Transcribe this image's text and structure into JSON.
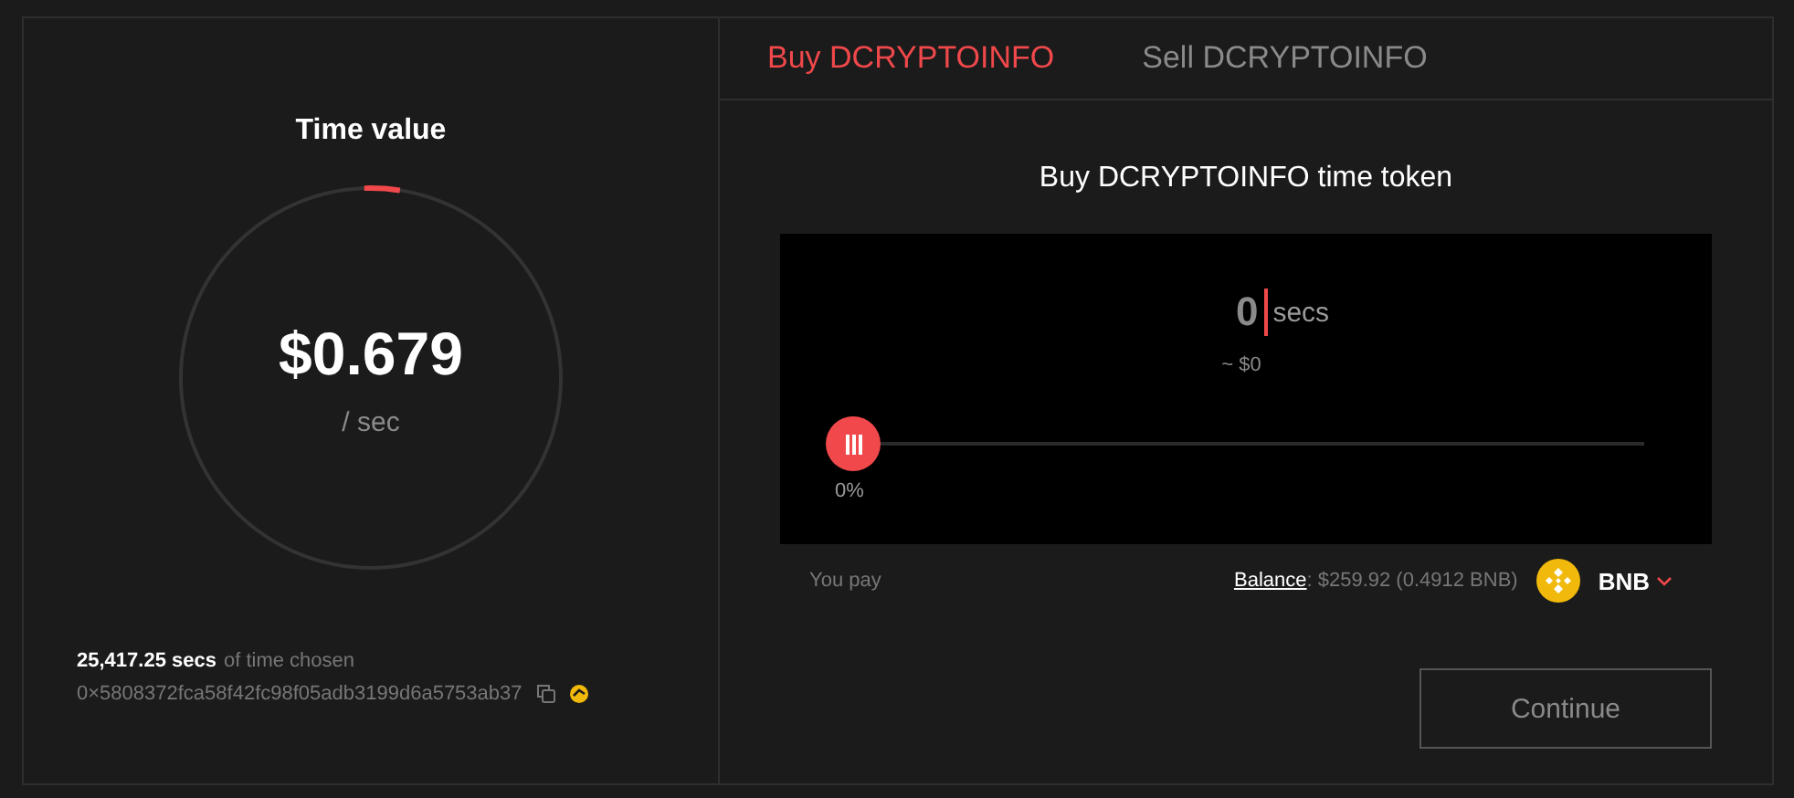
{
  "time_value": {
    "title": "Time value",
    "price": "$0.679",
    "unit": "/ sec",
    "level": 0.03
  },
  "chosen": {
    "amount": "25,417.25 secs",
    "suffix": "of time chosen",
    "address": "0×5808372fca58f42fc98f05adb3199d6a5753ab37"
  },
  "tabs": [
    {
      "label": "Buy DCRYPTOINFO",
      "selected": true
    },
    {
      "label": "Sell DCRYPTOINFO",
      "selected": false
    }
  ],
  "buy": {
    "title": "Buy DCRYPTOINFO time token",
    "amount": "0",
    "unit": "secs",
    "usd": "~ $0",
    "slider": {
      "level": 0,
      "reading": "0%"
    },
    "pay_label": "You pay",
    "balance_label": "Balance",
    "balance_value": ": $259.92 (0.4912 BNB)",
    "currency": "BNB",
    "button": "Continue"
  }
}
